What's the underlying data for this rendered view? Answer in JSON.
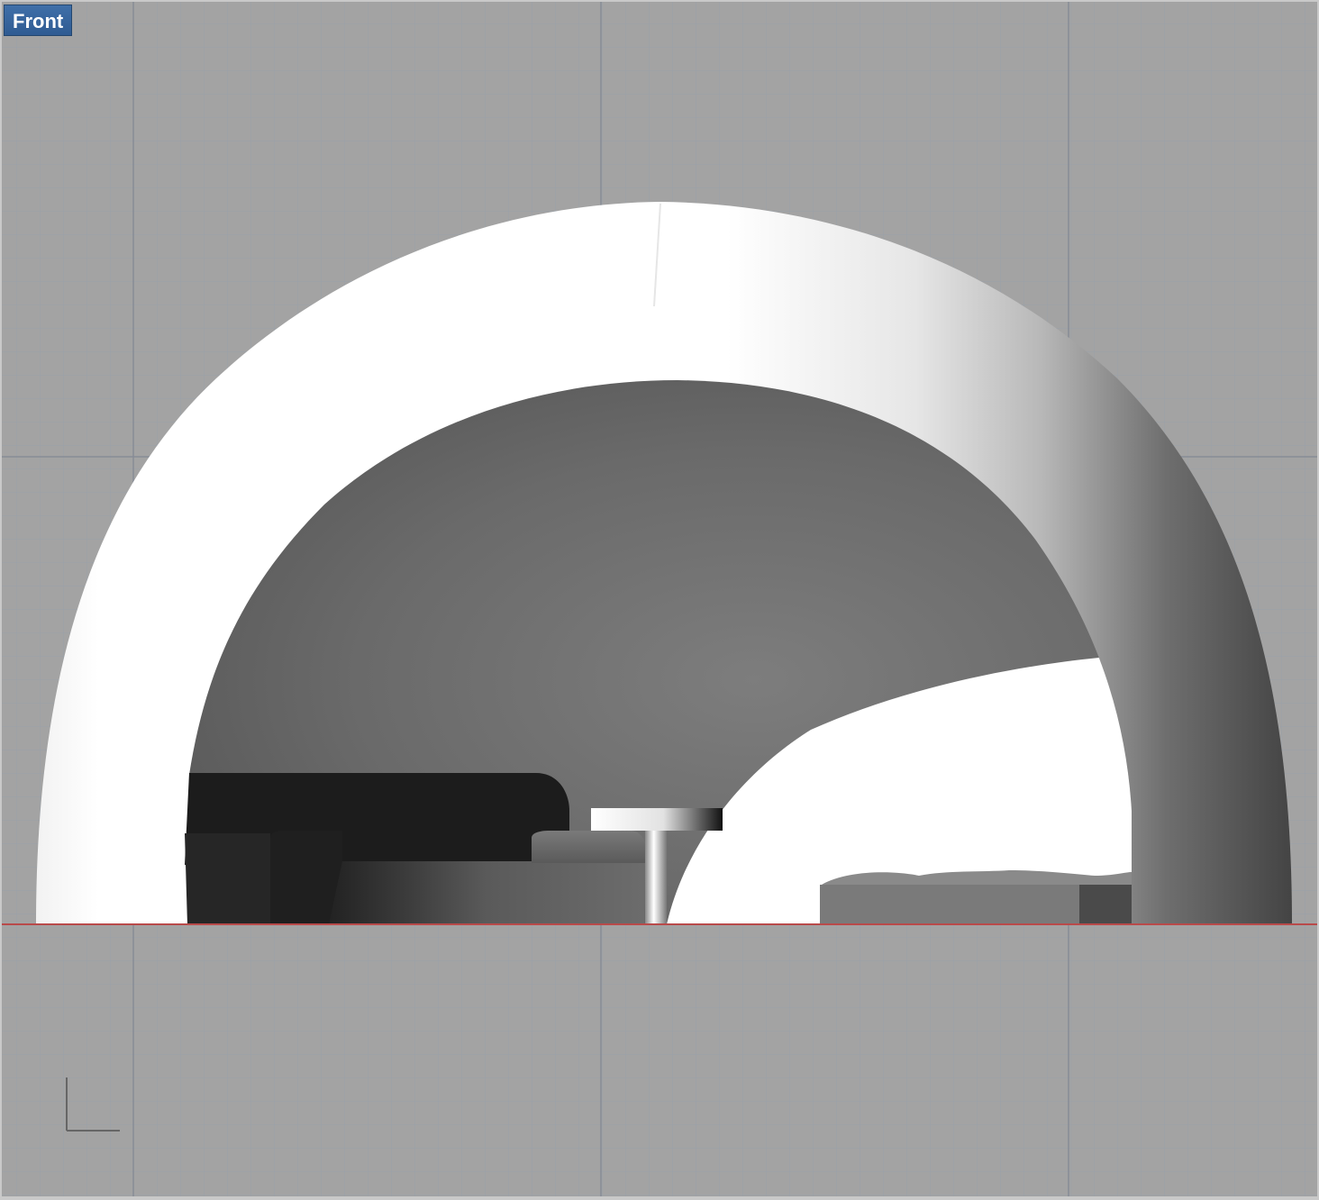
{
  "viewport": {
    "label": "Front",
    "view_type": "front-orthographic",
    "display_mode": "shaded",
    "grid_visible": true
  },
  "colors": {
    "background": "#a3a3a3",
    "grid_minor": "#9a9fa8",
    "grid_major": "#8a8f99",
    "ground_line": "#b94a4a",
    "label_bg": "#2f5b92",
    "label_text": "#ffffff",
    "dome_highlight": "#ffffff",
    "dome_shadow": "#444444",
    "interior_dark": "#5e5e5e",
    "dark_block": "#1c1c1c"
  },
  "icons": {
    "axes_widget": "axes-gizmo-icon"
  }
}
